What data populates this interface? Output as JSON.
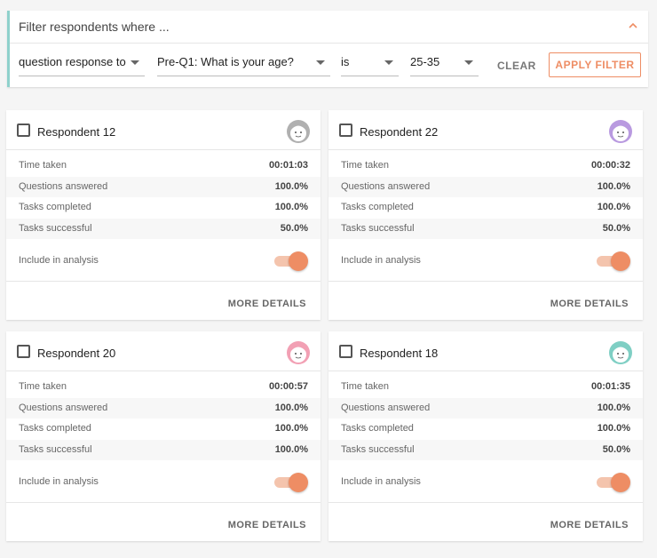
{
  "filter": {
    "title": "Filter respondents where ...",
    "field1": "question response to",
    "field2": "Pre-Q1: What is your age?",
    "operator": "is",
    "value": "25-35",
    "clear_label": "CLEAR",
    "apply_label": "APPLY FILTER"
  },
  "labels": {
    "time_taken": "Time taken",
    "questions_answered": "Questions answered",
    "tasks_completed": "Tasks completed",
    "tasks_successful": "Tasks successful",
    "include": "Include in analysis",
    "more_details": "MORE DETAILS"
  },
  "respondents": [
    {
      "name": "Respondent 12",
      "time": "00:01:03",
      "questions": "100.0%",
      "completed": "100.0%",
      "successful": "50.0%",
      "include": true,
      "avatar_color": "#b0b0b0"
    },
    {
      "name": "Respondent 22",
      "time": "00:00:32",
      "questions": "100.0%",
      "completed": "100.0%",
      "successful": "50.0%",
      "include": true,
      "avatar_color": "#b99ae0"
    },
    {
      "name": "Respondent 20",
      "time": "00:00:57",
      "questions": "100.0%",
      "completed": "100.0%",
      "successful": "100.0%",
      "include": true,
      "avatar_color": "#f2a0b4"
    },
    {
      "name": "Respondent 18",
      "time": "00:01:35",
      "questions": "100.0%",
      "completed": "100.0%",
      "successful": "50.0%",
      "include": true,
      "avatar_color": "#7fcfc4"
    }
  ],
  "colors": {
    "accent": "#ee8d64",
    "filter_bar": "#8fd1cc"
  }
}
